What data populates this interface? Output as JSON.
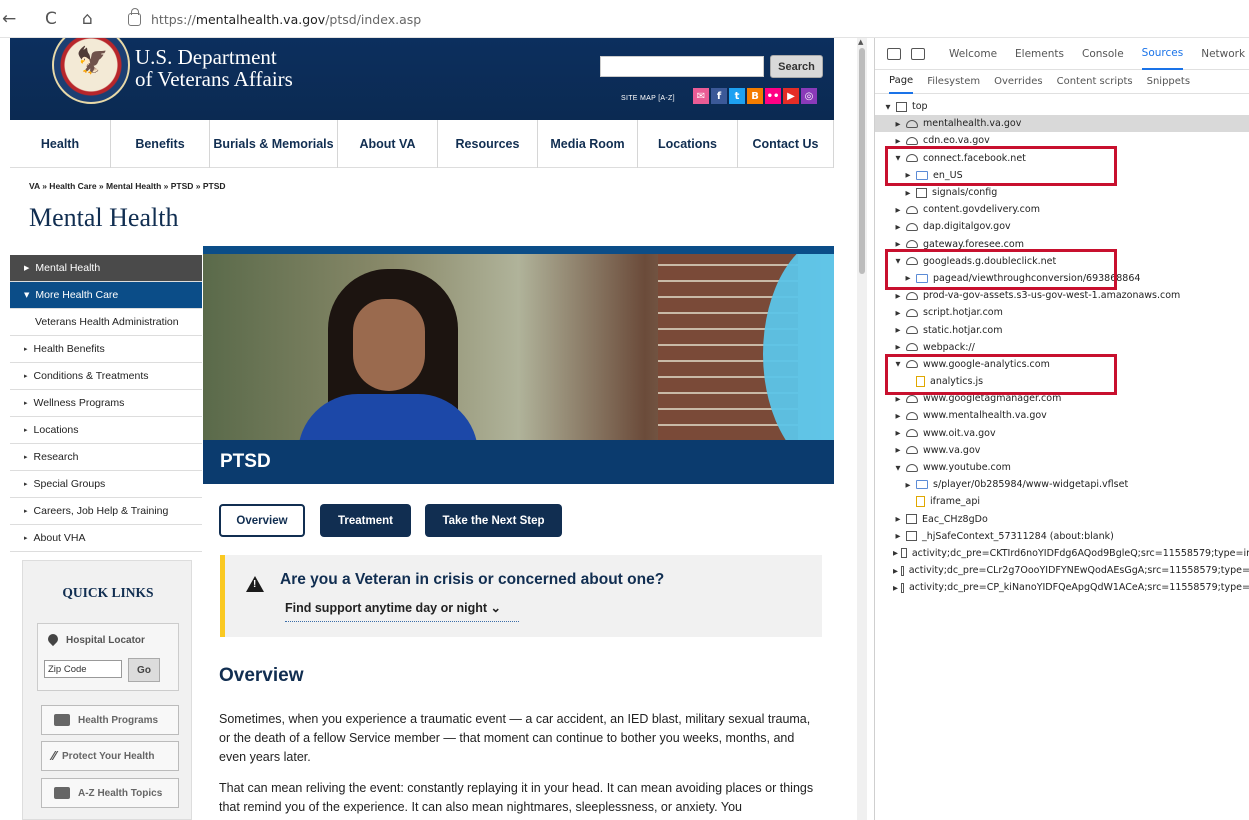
{
  "browser": {
    "url_scheme": "https://",
    "url_host": "mentalhealth.va.gov",
    "url_path": "/ptsd/index.asp",
    "back_glyph": "←",
    "reload_glyph": "C",
    "home_glyph": "⌂"
  },
  "header": {
    "title_line1": "U.S. Department",
    "title_line2": "of Veterans Affairs",
    "search_button": "Search",
    "site_map": "SITE MAP [A-Z]",
    "social_icons": [
      "email-icon",
      "facebook-icon",
      "twitter-icon",
      "blogger-icon",
      "flickr-icon",
      "youtube-icon",
      "instagram-icon"
    ],
    "social_colors": [
      "#e95c95",
      "#3b5998",
      "#1da1f2",
      "#f57d00",
      "#ff0084",
      "#e52d27",
      "#8a3ab9"
    ]
  },
  "mainnav": [
    "Health",
    "Benefits",
    "Burials & Memorials",
    "About VA",
    "Resources",
    "Media Room",
    "Locations",
    "Contact Us"
  ],
  "breadcrumb": "VA » Health Care » Mental Health » PTSD » PTSD",
  "page_heading": "Mental Health",
  "sidenav": [
    {
      "label": "Mental Health",
      "style": "dark",
      "caret": "▶"
    },
    {
      "label": "More Health Care",
      "style": "active",
      "caret": "▼"
    },
    {
      "label": "Veterans Health Administration",
      "style": "sub",
      "caret": ""
    },
    {
      "label": "Health Benefits",
      "style": "",
      "caret": "▸"
    },
    {
      "label": "Conditions & Treatments",
      "style": "",
      "caret": "▸"
    },
    {
      "label": "Wellness Programs",
      "style": "",
      "caret": "▸"
    },
    {
      "label": "Locations",
      "style": "",
      "caret": "▸"
    },
    {
      "label": "Research",
      "style": "",
      "caret": "▸"
    },
    {
      "label": "Special Groups",
      "style": "",
      "caret": "▸"
    },
    {
      "label": "Careers, Job Help & Training",
      "style": "",
      "caret": "▸"
    },
    {
      "label": "About VHA",
      "style": "",
      "caret": "▸"
    }
  ],
  "quick_links": {
    "title": "QUICK LINKS",
    "locator_label": "Hospital Locator",
    "zip_placeholder": "Zip Code",
    "go": "Go",
    "buttons": [
      "Health Programs",
      "Protect Your Health",
      "A-Z Health Topics"
    ]
  },
  "hero_title": "PTSD",
  "tabs": [
    "Overview",
    "Treatment",
    "Take the Next Step"
  ],
  "crisis": {
    "question": "Are you a Veteran in crisis or concerned about one?",
    "link": "Find support anytime day or night ⌄"
  },
  "overview": {
    "heading": "Overview",
    "para1": "Sometimes, when you experience a traumatic event — a car accident, an IED blast, military sexual trauma, or the death of a fellow Service member — that moment can continue to bother you weeks, months, and even years later.",
    "para2": "That can mean reliving the event: constantly replaying it in your head. It can mean avoiding places or things that remind you of the experience. It can also mean nightmares, sleeplessness, or anxiety. You"
  },
  "devtools": {
    "tabs": [
      "Welcome",
      "Elements",
      "Console",
      "Sources",
      "Network"
    ],
    "active_tab": "Sources",
    "subtabs": [
      "Page",
      "Filesystem",
      "Overrides",
      "Content scripts",
      "Snippets"
    ],
    "tree": [
      {
        "indent": 0,
        "tw": "▼",
        "icon": "frame",
        "label": "top"
      },
      {
        "indent": 1,
        "tw": "▶",
        "icon": "cloud",
        "label": "mentalhealth.va.gov",
        "sel": true
      },
      {
        "indent": 1,
        "tw": "▶",
        "icon": "cloud",
        "label": "cdn.eo.va.gov"
      },
      {
        "indent": 1,
        "tw": "▼",
        "icon": "cloud",
        "label": "connect.facebook.net"
      },
      {
        "indent": 2,
        "tw": "▶",
        "icon": "folder",
        "label": "en_US"
      },
      {
        "indent": 2,
        "tw": "▶",
        "icon": "frame",
        "label": "signals/config"
      },
      {
        "indent": 1,
        "tw": "▶",
        "icon": "cloud",
        "label": "content.govdelivery.com"
      },
      {
        "indent": 1,
        "tw": "▶",
        "icon": "cloud",
        "label": "dap.digitalgov.gov"
      },
      {
        "indent": 1,
        "tw": "▶",
        "icon": "cloud",
        "label": "gateway.foresee.com"
      },
      {
        "indent": 1,
        "tw": "▼",
        "icon": "cloud",
        "label": "googleads.g.doubleclick.net"
      },
      {
        "indent": 2,
        "tw": "▶",
        "icon": "folder",
        "label": "pagead/viewthroughconversion/693868864"
      },
      {
        "indent": 1,
        "tw": "▶",
        "icon": "cloud",
        "label": "prod-va-gov-assets.s3-us-gov-west-1.amazonaws.com"
      },
      {
        "indent": 1,
        "tw": "▶",
        "icon": "cloud",
        "label": "script.hotjar.com"
      },
      {
        "indent": 1,
        "tw": "▶",
        "icon": "cloud",
        "label": "static.hotjar.com"
      },
      {
        "indent": 1,
        "tw": "▶",
        "icon": "cloud",
        "label": "webpack://"
      },
      {
        "indent": 1,
        "tw": "▼",
        "icon": "cloud",
        "label": "www.google-analytics.com"
      },
      {
        "indent": 2,
        "tw": "",
        "icon": "file",
        "label": "analytics.js"
      },
      {
        "indent": 1,
        "tw": "▶",
        "icon": "cloud",
        "label": "www.googletagmanager.com"
      },
      {
        "indent": 1,
        "tw": "▶",
        "icon": "cloud",
        "label": "www.mentalhealth.va.gov"
      },
      {
        "indent": 1,
        "tw": "▶",
        "icon": "cloud",
        "label": "www.oit.va.gov"
      },
      {
        "indent": 1,
        "tw": "▶",
        "icon": "cloud",
        "label": "www.va.gov"
      },
      {
        "indent": 1,
        "tw": "▼",
        "icon": "cloud",
        "label": "www.youtube.com"
      },
      {
        "indent": 2,
        "tw": "▶",
        "icon": "folder",
        "label": "s/player/0b285984/www-widgetapi.vflset"
      },
      {
        "indent": 2,
        "tw": "",
        "icon": "file",
        "label": "iframe_api"
      },
      {
        "indent": 1,
        "tw": "▶",
        "icon": "frame",
        "label": "Eac_CHz8gDo"
      },
      {
        "indent": 1,
        "tw": "▶",
        "icon": "frame",
        "label": "_hjSafeContext_57311284 (about:blank)"
      },
      {
        "indent": 1,
        "tw": "▶",
        "icon": "frame",
        "label": "activity;dc_pre=CKTIrd6noYIDFdg6AQod9BgleQ;src=11558579;type=ir"
      },
      {
        "indent": 1,
        "tw": "▶",
        "icon": "frame",
        "label": "activity;dc_pre=CLr2g7OooYIDFYNEwQodAEsGgA;src=11558579;type="
      },
      {
        "indent": 1,
        "tw": "▶",
        "icon": "frame",
        "label": "activity;dc_pre=CP_kiNanoYIDFQeApgQdW1ACeA;src=11558579;type="
      }
    ]
  },
  "highlight_color": "#c8102e"
}
